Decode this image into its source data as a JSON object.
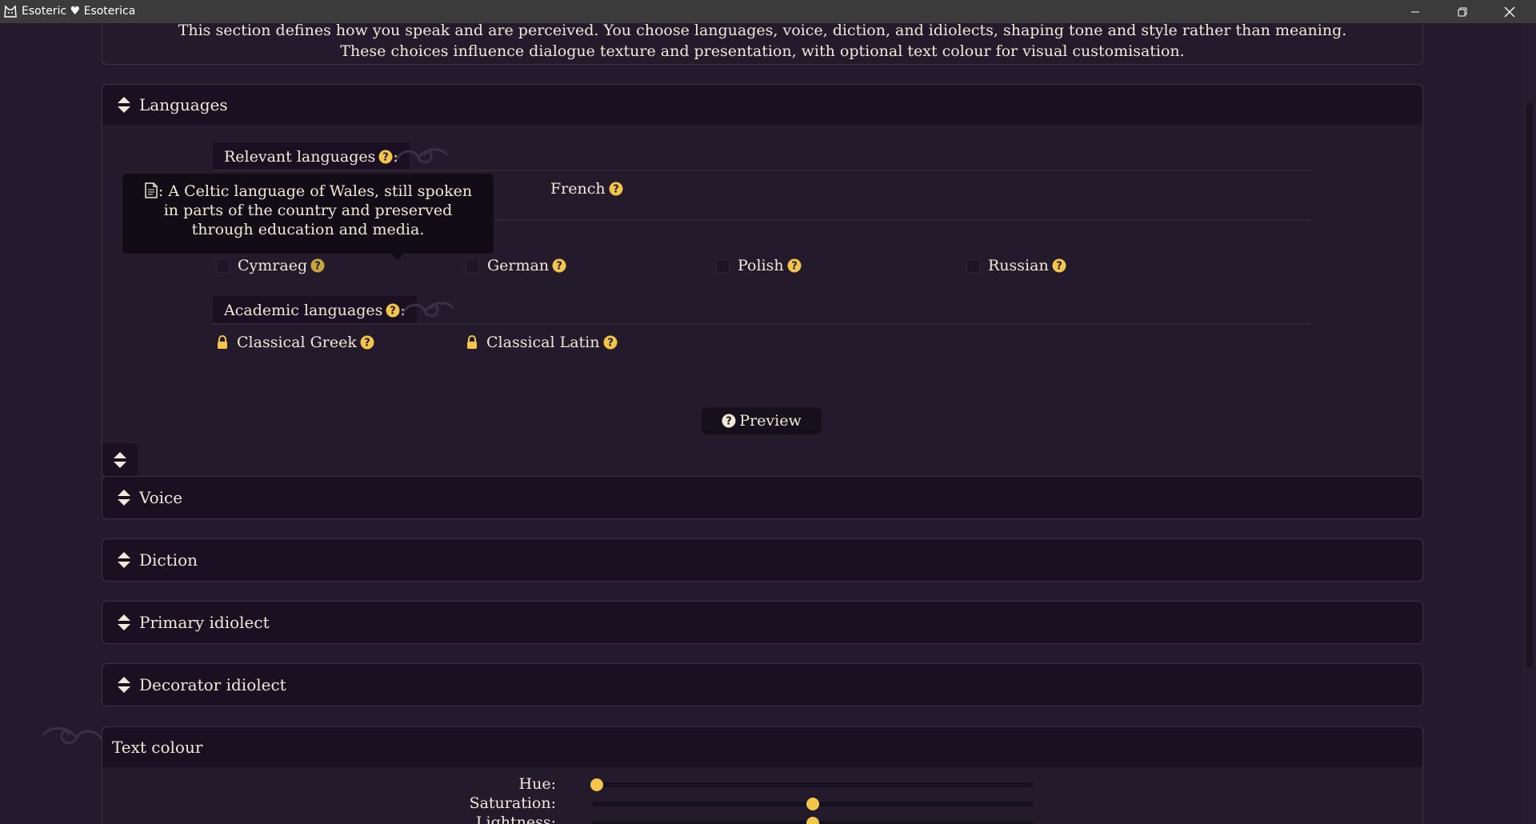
{
  "window": {
    "title": "Esoteric ♥ Esoterica",
    "controls": [
      "minimize-icon",
      "maximize-icon",
      "close-icon"
    ]
  },
  "intro": {
    "line1": "This section defines how you speak and are perceived. You choose languages, voice, diction, and idiolects, shaping tone and style rather than meaning.",
    "line2": "These choices influence dialogue texture and presentation, with optional text colour for visual customisation."
  },
  "languages": {
    "header": "Languages",
    "relevant_label": "Relevant languages",
    "relevant_colon": ":",
    "relevant_items": [
      {
        "label": "French",
        "checked": true
      }
    ],
    "other_items": [
      {
        "label": "Cymraeg",
        "checked": false
      },
      {
        "label": "German",
        "checked": false
      },
      {
        "label": "Polish",
        "checked": false
      },
      {
        "label": "Russian",
        "checked": false
      }
    ],
    "academic_label": "Academic languages",
    "academic_colon": ":",
    "academic_items": [
      {
        "label": "Classical Greek",
        "locked": true
      },
      {
        "label": "Classical Latin",
        "locked": true
      }
    ],
    "preview_label": "Preview"
  },
  "tooltip": {
    "prefix": ":",
    "text": "A Celtic language of Wales, still spoken in parts of the country and preserved through education and media."
  },
  "sections": [
    {
      "label": "Voice"
    },
    {
      "label": "Diction"
    },
    {
      "label": "Primary idiolect"
    },
    {
      "label": "Decorator idiolect"
    }
  ],
  "text_colour": {
    "header": "Text colour",
    "sliders": [
      {
        "label": "Hue:",
        "value": 0.01
      },
      {
        "label": "Saturation:",
        "value": 0.5
      },
      {
        "label": "Lightness:",
        "value": 0.5
      }
    ]
  },
  "colors": {
    "accent": "#f3c54a",
    "background": "#241a2d",
    "panel_header": "#1a1022",
    "text": "#f1e9d6"
  }
}
